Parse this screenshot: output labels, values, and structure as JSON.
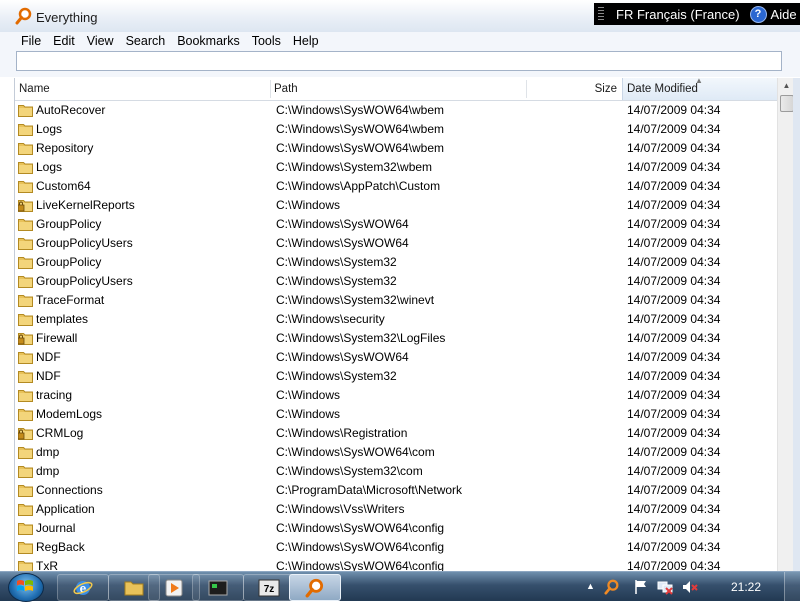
{
  "window": {
    "title": "Everything",
    "icon": "magnifier-icon"
  },
  "language_bar": {
    "language": "FR Français (France)",
    "help_label": "Aide",
    "help_icon": "help-icon"
  },
  "menu": {
    "items": [
      "File",
      "Edit",
      "View",
      "Search",
      "Bookmarks",
      "Tools",
      "Help"
    ]
  },
  "search": {
    "value": "",
    "placeholder": ""
  },
  "list": {
    "columns": {
      "name": "Name",
      "path": "Path",
      "size": "Size",
      "date": "Date Modified"
    },
    "sort_column": "Date Modified",
    "rows": [
      {
        "name": "AutoRecover",
        "path": "C:\\Windows\\SysWOW64\\wbem",
        "date": "14/07/2009 04:34",
        "locked": false
      },
      {
        "name": "Logs",
        "path": "C:\\Windows\\SysWOW64\\wbem",
        "date": "14/07/2009 04:34",
        "locked": false
      },
      {
        "name": "Repository",
        "path": "C:\\Windows\\SysWOW64\\wbem",
        "date": "14/07/2009 04:34",
        "locked": false
      },
      {
        "name": "Logs",
        "path": "C:\\Windows\\System32\\wbem",
        "date": "14/07/2009 04:34",
        "locked": false
      },
      {
        "name": "Custom64",
        "path": "C:\\Windows\\AppPatch\\Custom",
        "date": "14/07/2009 04:34",
        "locked": false
      },
      {
        "name": "LiveKernelReports",
        "path": "C:\\Windows",
        "date": "14/07/2009 04:34",
        "locked": true
      },
      {
        "name": "GroupPolicy",
        "path": "C:\\Windows\\SysWOW64",
        "date": "14/07/2009 04:34",
        "locked": false
      },
      {
        "name": "GroupPolicyUsers",
        "path": "C:\\Windows\\SysWOW64",
        "date": "14/07/2009 04:34",
        "locked": false
      },
      {
        "name": "GroupPolicy",
        "path": "C:\\Windows\\System32",
        "date": "14/07/2009 04:34",
        "locked": false
      },
      {
        "name": "GroupPolicyUsers",
        "path": "C:\\Windows\\System32",
        "date": "14/07/2009 04:34",
        "locked": false
      },
      {
        "name": "TraceFormat",
        "path": "C:\\Windows\\System32\\winevt",
        "date": "14/07/2009 04:34",
        "locked": false
      },
      {
        "name": "templates",
        "path": "C:\\Windows\\security",
        "date": "14/07/2009 04:34",
        "locked": false
      },
      {
        "name": "Firewall",
        "path": "C:\\Windows\\System32\\LogFiles",
        "date": "14/07/2009 04:34",
        "locked": true
      },
      {
        "name": "NDF",
        "path": "C:\\Windows\\SysWOW64",
        "date": "14/07/2009 04:34",
        "locked": false
      },
      {
        "name": "NDF",
        "path": "C:\\Windows\\System32",
        "date": "14/07/2009 04:34",
        "locked": false
      },
      {
        "name": "tracing",
        "path": "C:\\Windows",
        "date": "14/07/2009 04:34",
        "locked": false
      },
      {
        "name": "ModemLogs",
        "path": "C:\\Windows",
        "date": "14/07/2009 04:34",
        "locked": false
      },
      {
        "name": "CRMLog",
        "path": "C:\\Windows\\Registration",
        "date": "14/07/2009 04:34",
        "locked": true
      },
      {
        "name": "dmp",
        "path": "C:\\Windows\\SysWOW64\\com",
        "date": "14/07/2009 04:34",
        "locked": false
      },
      {
        "name": "dmp",
        "path": "C:\\Windows\\System32\\com",
        "date": "14/07/2009 04:34",
        "locked": false
      },
      {
        "name": "Connections",
        "path": "C:\\ProgramData\\Microsoft\\Network",
        "date": "14/07/2009 04:34",
        "locked": false
      },
      {
        "name": "Application",
        "path": "C:\\Windows\\Vss\\Writers",
        "date": "14/07/2009 04:34",
        "locked": false
      },
      {
        "name": "Journal",
        "path": "C:\\Windows\\SysWOW64\\config",
        "date": "14/07/2009 04:34",
        "locked": false
      },
      {
        "name": "RegBack",
        "path": "C:\\Windows\\SysWOW64\\config",
        "date": "14/07/2009 04:34",
        "locked": false
      },
      {
        "name": "TxR",
        "path": "C:\\Windows\\SysWOW64\\config",
        "date": "14/07/2009 04:34",
        "locked": false
      }
    ]
  },
  "taskbar": {
    "buttons": [
      "internet-explorer-icon",
      "folder-icon",
      "media-player-icon",
      "terminal-icon",
      "7zip-icon",
      "everything-icon"
    ],
    "button_7z_label": "7z",
    "active": "everything-icon",
    "tray": [
      "everything-tray-icon",
      "flag-icon",
      "network-icon",
      "volume-muted-icon"
    ],
    "clock": "21:22"
  },
  "colors": {
    "accent": "#2b67d1",
    "folder": "#e8c25a",
    "taskbar": "#36506d"
  }
}
